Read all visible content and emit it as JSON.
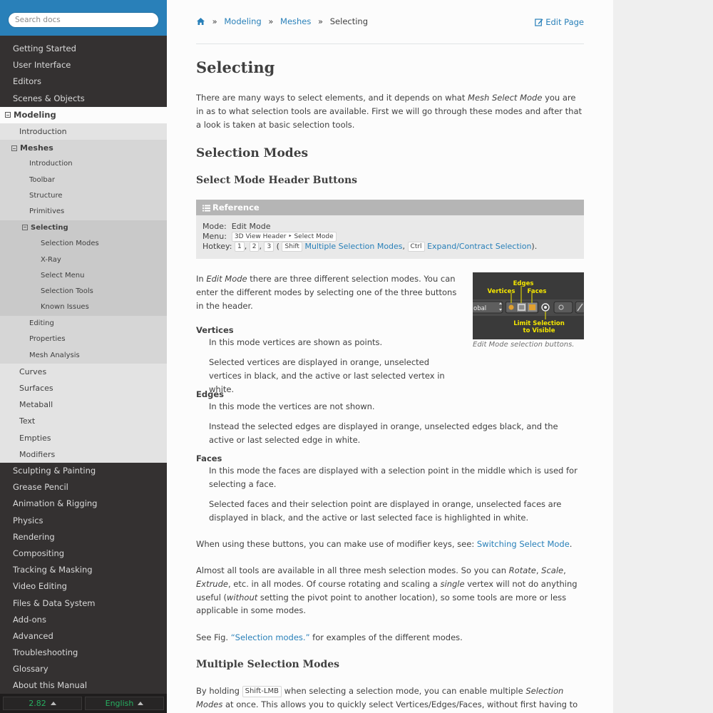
{
  "search": {
    "placeholder": "Search docs"
  },
  "sidebar": {
    "top_items": [
      "Getting Started",
      "User Interface",
      "Editors",
      "Scenes & Objects"
    ],
    "current_top": "Modeling",
    "modeling_children_before": [
      "Introduction"
    ],
    "current_l2": "Meshes",
    "meshes_children_before": [
      "Introduction",
      "Toolbar",
      "Structure",
      "Primitives"
    ],
    "current_l3": "Selecting",
    "selecting_children": [
      "Selection Modes",
      "X-Ray",
      "Select Menu",
      "Selection Tools",
      "Known Issues"
    ],
    "meshes_children_after": [
      "Editing",
      "Properties",
      "Mesh Analysis"
    ],
    "modeling_children_after": [
      "Curves",
      "Surfaces",
      "Metaball",
      "Text",
      "Empties",
      "Modifiers"
    ],
    "bottom_items": [
      "Sculpting & Painting",
      "Grease Pencil",
      "Animation & Rigging",
      "Physics",
      "Rendering",
      "Compositing",
      "Tracking & Masking",
      "Video Editing",
      "Files & Data System",
      "Add-ons",
      "Advanced",
      "Troubleshooting",
      "Glossary",
      "About this Manual"
    ]
  },
  "version_bar": {
    "version": "2.82",
    "language": "English"
  },
  "breadcrumbs": {
    "items": [
      "Modeling",
      "Meshes"
    ],
    "current": "Selecting",
    "edit_page": "Edit Page"
  },
  "page": {
    "title": "Selecting",
    "intro_a": "There are many ways to select elements, and it depends on what ",
    "intro_em": "Mesh Select Mode",
    "intro_b": " you are in as to what selection tools are available. First we will go through these modes and after that a look is taken at basic selection tools.",
    "h2_selection_modes": "Selection Modes",
    "h3_header_buttons": "Select Mode Header Buttons",
    "reference": {
      "title": "Reference",
      "mode_label": "Mode:",
      "mode_value": "Edit Mode",
      "menu_label": "Menu:",
      "menu_value": "3D View Header ‣ Select Mode",
      "hotkey_label": "Hotkey:",
      "key1": "1",
      "key2": "2",
      "key3": "3",
      "key_shift": "Shift",
      "link_multiple": "Multiple Selection Modes",
      "key_ctrl": "Ctrl",
      "link_expand": "Expand/Contract Selection"
    },
    "edit_mode_a": "In ",
    "edit_mode_em": "Edit Mode",
    "edit_mode_b": " there are three different selection modes. You can enter the different modes by selecting one of the three buttons in the header.",
    "figure": {
      "label_edges": "Edges",
      "label_vertices": "Vertices",
      "label_faces": "Faces",
      "label_limit_1": "Limit Selection",
      "label_limit_2": "to Visible",
      "global_text": "obal",
      "caption": "Edit Mode selection buttons."
    },
    "vertices_term": "Vertices",
    "vertices_p1": "In this mode vertices are shown as points.",
    "vertices_p2": "Selected vertices are displayed in orange, unselected vertices in black, and the active or last selected vertex in white.",
    "edges_term": "Edges",
    "edges_p1": "In this mode the vertices are not shown.",
    "edges_p2": "Instead the selected edges are displayed in orange, unselected edges black, and the active or last selected edge in white.",
    "faces_term": "Faces",
    "faces_p1": "In this mode the faces are displayed with a selection point in the middle which is used for selecting a face.",
    "faces_p2": "Selected faces and their selection point are displayed in orange, unselected faces are displayed in black, and the active or last selected face is highlighted in white.",
    "modifier_a": "When using these buttons, you can make use of modifier keys, see: ",
    "modifier_link": "Switching Select Mode",
    "modifier_b": ".",
    "tools_a": "Almost all tools are available in all three mesh selection modes. So you can ",
    "tools_rotate": "Rotate",
    "tools_sep1": ", ",
    "tools_scale": "Scale",
    "tools_sep2": ", ",
    "tools_extrude": "Extrude",
    "tools_b": ", etc. in all modes. Of course rotating and scaling a ",
    "tools_single": "single",
    "tools_c": " vertex will not do anything useful (",
    "tools_without": "without",
    "tools_d": " setting the pivot point to another location), so some tools are more or less applicable in some modes.",
    "see_a": "See Fig. ",
    "see_link": "“Selection modes.”",
    "see_b": " for examples of the different modes.",
    "h3_multiple": "Multiple Selection Modes",
    "multi_a": "By holding ",
    "multi_key": "Shift-LMB",
    "multi_b": " when selecting a selection mode, you can enable multiple ",
    "multi_em": "Selection Modes",
    "multi_c": " at once. This allows you to quickly select Vertices/Edges/Faces, without first having to switch modes."
  },
  "colors": {
    "sidebar_bg": "#343131",
    "accent": "#2980b9",
    "version_green": "#27ae60",
    "figure_label": "#f4e600"
  }
}
